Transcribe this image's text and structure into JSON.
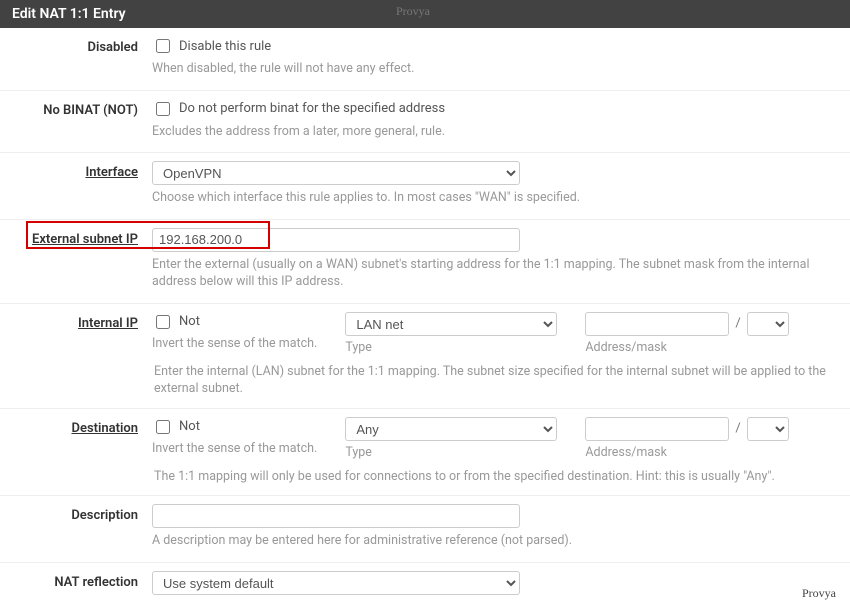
{
  "header": {
    "title": "Edit NAT 1:1 Entry",
    "watermark": "Provya"
  },
  "disabled": {
    "label": "Disabled",
    "checkbox_label": "Disable this rule",
    "help": "When disabled, the rule will not have any effect."
  },
  "nobinat": {
    "label": "No BINAT (NOT)",
    "checkbox_label": "Do not perform binat for the specified address",
    "help": "Excludes the address from a later, more general, rule."
  },
  "interface": {
    "label": "Interface",
    "value": "OpenVPN",
    "help": "Choose which interface this rule applies to. In most cases \"WAN\" is specified."
  },
  "external": {
    "label": "External subnet IP",
    "value": "192.168.200.0",
    "help": "Enter the external (usually on a WAN) subnet's starting address for the 1:1 mapping. The subnet mask from the internal address below will this IP address."
  },
  "internal": {
    "label": "Internal IP",
    "not_label": "Not",
    "not_help": "Invert the sense of the match.",
    "type_label": "Type",
    "type_value": "LAN net",
    "addr_label": "Address/mask",
    "addr_value": "",
    "mask_value": "",
    "help": "Enter the internal (LAN) subnet for the 1:1 mapping. The subnet size specified for the internal subnet will be applied to the external subnet."
  },
  "destination": {
    "label": "Destination",
    "not_label": "Not",
    "not_help": "Invert the sense of the match.",
    "type_label": "Type",
    "type_value": "Any",
    "addr_label": "Address/mask",
    "addr_value": "",
    "mask_value": "",
    "help": "The 1:1 mapping will only be used for connections to or from the specified destination. Hint: this is usually \"Any\"."
  },
  "description": {
    "label": "Description",
    "value": "",
    "help": "A description may be entered here for administrative reference (not parsed)."
  },
  "nat_reflection": {
    "label": "NAT reflection",
    "value": "Use system default"
  }
}
